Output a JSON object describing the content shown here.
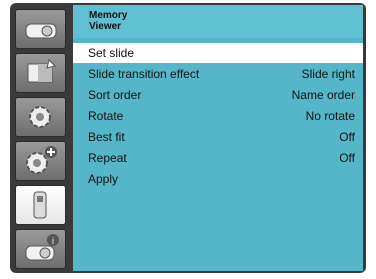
{
  "header": {
    "title_line1": "Memory",
    "title_line2": "Viewer"
  },
  "sidebar": {
    "tabs": [
      {
        "name": "display-settings-tab",
        "icon": "projector-icon",
        "active": false
      },
      {
        "name": "image-adjust-tab",
        "icon": "image-adjust-icon",
        "active": false
      },
      {
        "name": "settings-tab",
        "icon": "gear-icon",
        "active": false
      },
      {
        "name": "extended-settings-tab",
        "icon": "gear-plus-icon",
        "active": false
      },
      {
        "name": "memory-viewer-tab",
        "icon": "usb-icon",
        "active": true
      },
      {
        "name": "info-tab",
        "icon": "projector-info-icon",
        "active": false
      }
    ]
  },
  "menu": {
    "items": [
      {
        "label": "Set slide",
        "value": "",
        "selected": true
      },
      {
        "label": "Slide transition effect",
        "value": "Slide right",
        "selected": false
      },
      {
        "label": "Sort order",
        "value": "Name order",
        "selected": false
      },
      {
        "label": "Rotate",
        "value": "No rotate",
        "selected": false
      },
      {
        "label": "Best fit",
        "value": "Off",
        "selected": false
      },
      {
        "label": "Repeat",
        "value": "Off",
        "selected": false
      },
      {
        "label": "Apply",
        "value": "",
        "selected": false
      }
    ]
  },
  "colors": {
    "panel": "#55b6c9",
    "selected_row": "#ffffff",
    "frame": "#3a3a3a"
  }
}
